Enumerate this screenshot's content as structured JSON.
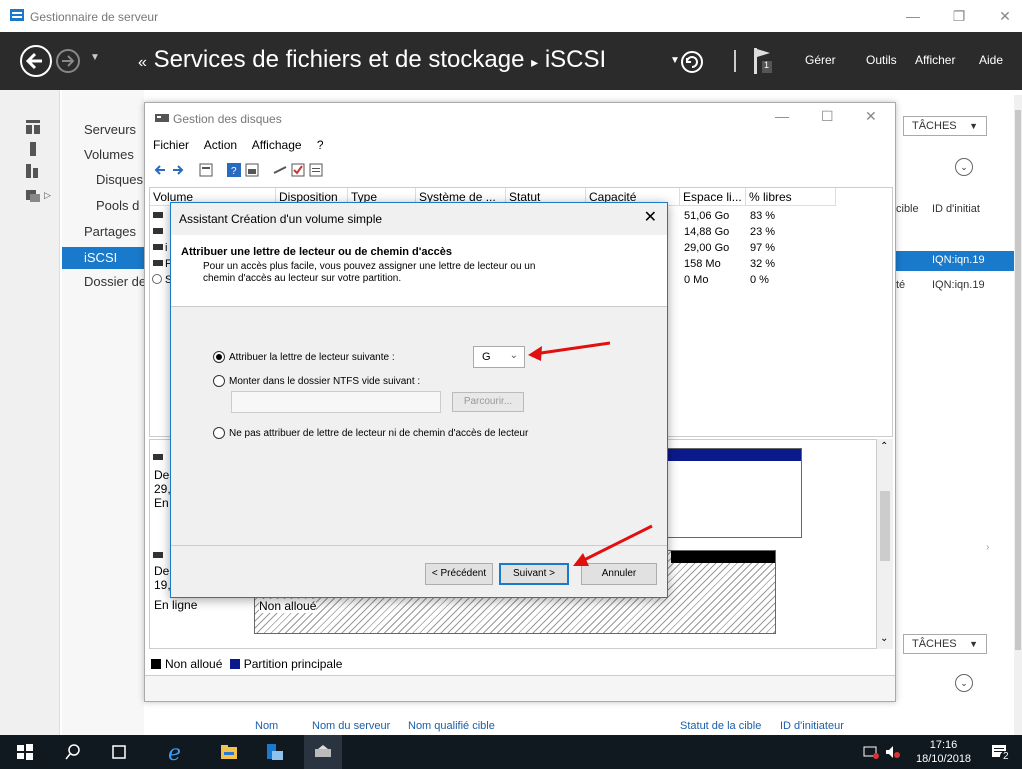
{
  "window": {
    "title": "Gestionnaire de serveur",
    "breadcrumb_prefix": "«",
    "breadcrumb": "Services de fichiers et de stockage",
    "breadcrumb_sep": "▸",
    "breadcrumb_current": "iSCSI",
    "flag_badge": "1",
    "menu": [
      "Gérer",
      "Outils",
      "Afficher",
      "Aide"
    ]
  },
  "nav": {
    "items": [
      "Serveurs",
      "Volumes",
      "Disques",
      "Pools d",
      "Partages",
      "iSCSI",
      "Dossier de"
    ],
    "active": "iSCSI"
  },
  "right_panel": {
    "taches_label": "TÂCHES",
    "col_cible": "cible",
    "col_initiateur": "ID d'initiat",
    "row1_value": "IQN:iqn.19",
    "row2_prefix": "té",
    "row2_value": "IQN:iqn.19"
  },
  "bottom_columns": [
    "Nom",
    "Nom du serveur",
    "Nom qualifié cible",
    "Statut de la cible",
    "ID d'initiateur"
  ],
  "disk_mgmt": {
    "title": "Gestion des disques",
    "menu": [
      "Fichier",
      "Action",
      "Affichage",
      "?"
    ],
    "columns": [
      "Volume",
      "Disposition",
      "Type",
      "Système de ...",
      "Statut",
      "Capacité",
      "Espace li...",
      "% libres"
    ],
    "rows": [
      {
        "free": "51,06 Go",
        "pct": "83 %"
      },
      {
        "free": "14,88 Go",
        "pct": "23 %"
      },
      {
        "free": "29,00 Go",
        "pct": "97 %"
      },
      {
        "free": "158 Mo",
        "pct": "32 %"
      },
      {
        "free": "0 Mo",
        "pct": "0 %"
      }
    ],
    "row_initials": [
      "",
      "",
      "i",
      "F",
      "S"
    ],
    "disk1": {
      "l1": "De",
      "l2": "29,",
      "l3": "En"
    },
    "disk2": {
      "l1": "De",
      "l2": "19,",
      "l3": "En ligne",
      "unallocated": "Non alloué"
    },
    "legend": {
      "unallocated": "Non alloué",
      "primary": "Partition principale"
    },
    "colors": {
      "primary": "#0a1a8c",
      "unallocated": "#000000"
    }
  },
  "wizard": {
    "title": "Assistant Création d'un volume simple",
    "heading": "Attribuer une lettre de lecteur ou de chemin d'accès",
    "description": "Pour un accès plus facile, vous pouvez assigner une lettre de lecteur ou un chemin d'accès au lecteur sur votre partition.",
    "option_letter": "Attribuer la lettre de lecteur suivante :",
    "option_ntfs": "Monter dans le dossier NTFS vide suivant :",
    "option_none": "Ne pas attribuer de lettre de lecteur ni de chemin d'accès de lecteur",
    "selected_letter": "G",
    "browse": "Parcourir...",
    "btn_prev": "< Précédent",
    "btn_next": "Suivant >",
    "btn_cancel": "Annuler"
  },
  "taskbar": {
    "time": "17:16",
    "date": "18/10/2018",
    "notifications": "2"
  },
  "accent": "#1979ca"
}
